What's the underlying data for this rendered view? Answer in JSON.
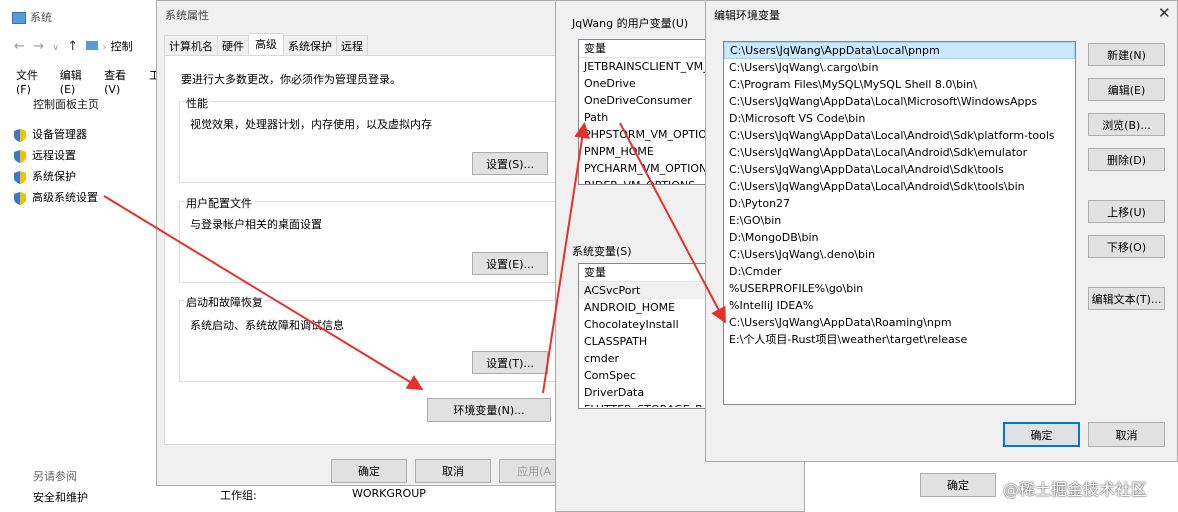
{
  "sys": {
    "title": "系统",
    "breadcrumb": "控制",
    "menu": [
      "文件(F)",
      "编辑(E)",
      "查看(V)",
      "工"
    ],
    "home": "控制面板主页",
    "links": [
      "设备管理器",
      "远程设置",
      "系统保护",
      "高级系统设置"
    ],
    "see_also": "另请参阅",
    "security": "安全和维护",
    "workgroup_label": "工作组:",
    "workgroup_value": "WORKGROUP"
  },
  "props": {
    "title": "系统属性",
    "tabs": [
      "计算机名",
      "硬件",
      "高级",
      "系统保护",
      "远程"
    ],
    "admin_note": "要进行大多数更改，你必须作为管理员登录。",
    "perf_title": "性能",
    "perf_desc": "视觉效果，处理器计划，内存使用，以及虚拟内存",
    "settings_s": "设置(S)...",
    "profile_title": "用户配置文件",
    "profile_desc": "与登录帐户相关的桌面设置",
    "settings_e": "设置(E)...",
    "startup_title": "启动和故障恢复",
    "startup_desc": "系统启动、系统故障和调试信息",
    "settings_t": "设置(T)...",
    "env_button": "环境变量(N)...",
    "ok": "确定",
    "cancel": "取消",
    "apply": "应用(A"
  },
  "env": {
    "user_vars_label": "JqWang 的用户变量(U)",
    "var_header": "变量",
    "user_vars": [
      "JETBRAINSCLIENT_VM_O",
      "OneDrive",
      "OneDriveConsumer",
      "Path",
      "PHPSTORM_VM_OPTION",
      "PNPM_HOME",
      "PYCHARM_VM_OPTIONS",
      "RIDER_VM_OPTIONS"
    ],
    "sys_vars_label": "系统变量(S)",
    "sys_vars": [
      "ACSvcPort",
      "ANDROID_HOME",
      "ChocolateyInstall",
      "CLASSPATH",
      "cmder",
      "ComSpec",
      "DriverData",
      "FLUTTER_STORAGE_BAS"
    ],
    "ok": "确定"
  },
  "edit": {
    "title": "编辑环境变量",
    "paths": [
      "C:\\Users\\JqWang\\AppData\\Local\\pnpm",
      "C:\\Users\\JqWang\\.cargo\\bin",
      "C:\\Program Files\\MySQL\\MySQL Shell 8.0\\bin\\",
      "C:\\Users\\JqWang\\AppData\\Local\\Microsoft\\WindowsApps",
      "D:\\Microsoft VS Code\\bin",
      "C:\\Users\\JqWang\\AppData\\Local\\Android\\Sdk\\platform-tools",
      "C:\\Users\\JqWang\\AppData\\Local\\Android\\Sdk\\emulator",
      "C:\\Users\\JqWang\\AppData\\Local\\Android\\Sdk\\tools",
      "C:\\Users\\JqWang\\AppData\\Local\\Android\\Sdk\\tools\\bin",
      "D:\\Pyton27",
      "E:\\GO\\bin",
      "D:\\MongoDB\\bin",
      "C:\\Users\\JqWang\\.deno\\bin",
      "D:\\Cmder",
      "%USERPROFILE%\\go\\bin",
      "%IntelliJ IDEA%",
      "C:\\Users\\JqWang\\AppData\\Roaming\\npm",
      "E:\\个人项目-Rust项目\\weather\\target\\release"
    ],
    "new": "新建(N)",
    "edit": "编辑(E)",
    "browse": "浏览(B)...",
    "delete": "删除(D)",
    "up": "上移(U)",
    "down": "下移(O)",
    "edit_text": "编辑文本(T)...",
    "ok": "确定",
    "cancel": "取消"
  },
  "watermark": "@稀土掘金技术社区",
  "colors": {
    "accent": "#0078d7",
    "selection": "#cce8ff",
    "arrow": "#e8302a"
  }
}
